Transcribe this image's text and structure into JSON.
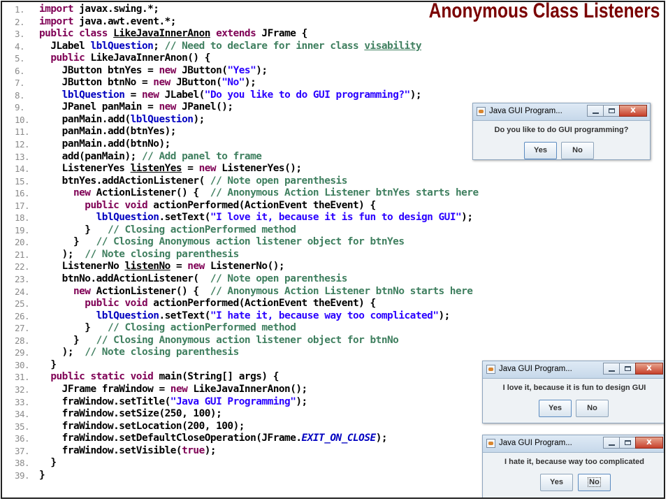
{
  "slide_title": "Anonymous Class Listeners",
  "code_lines": [
    {
      "n": "1.",
      "segs": [
        {
          "c": "kw",
          "t": "import "
        },
        {
          "c": "id",
          "t": "javax.swing.*;"
        }
      ]
    },
    {
      "n": "2.",
      "segs": [
        {
          "c": "kw",
          "t": "import "
        },
        {
          "c": "id",
          "t": "java.awt.event.*;"
        }
      ]
    },
    {
      "n": "3.",
      "segs": [
        {
          "c": "kw",
          "t": "public class "
        },
        {
          "c": "id ul",
          "t": "LikeJavaInnerAnon"
        },
        {
          "c": "kw",
          "t": " extends "
        },
        {
          "c": "id",
          "t": "JFrame {"
        }
      ]
    },
    {
      "n": "4.",
      "segs": [
        {
          "c": "id",
          "t": "  JLabel "
        },
        {
          "c": "vr",
          "t": "lblQuestion"
        },
        {
          "c": "id",
          "t": "; "
        },
        {
          "c": "cm",
          "t": "// Need to declare for inner class "
        },
        {
          "c": "cm ul",
          "t": "visability"
        }
      ]
    },
    {
      "n": "5.",
      "segs": [
        {
          "c": "kw",
          "t": "  public "
        },
        {
          "c": "id",
          "t": "LikeJavaInnerAnon() {"
        }
      ]
    },
    {
      "n": "6.",
      "segs": [
        {
          "c": "id",
          "t": "    JButton btnYes = "
        },
        {
          "c": "kw",
          "t": "new "
        },
        {
          "c": "id",
          "t": "JButton("
        },
        {
          "c": "st",
          "t": "\"Yes\""
        },
        {
          "c": "id",
          "t": ");"
        }
      ]
    },
    {
      "n": "7.",
      "segs": [
        {
          "c": "id",
          "t": "    JButton btnNo = "
        },
        {
          "c": "kw",
          "t": "new "
        },
        {
          "c": "id",
          "t": "JButton("
        },
        {
          "c": "st",
          "t": "\"No\""
        },
        {
          "c": "id",
          "t": ");"
        }
      ]
    },
    {
      "n": "8.",
      "segs": [
        {
          "c": "vr",
          "t": "    lblQuestion"
        },
        {
          "c": "id",
          "t": " = "
        },
        {
          "c": "kw",
          "t": "new "
        },
        {
          "c": "id",
          "t": "JLabel("
        },
        {
          "c": "st",
          "t": "\"Do you like to do GUI programming?\""
        },
        {
          "c": "id",
          "t": ");"
        }
      ]
    },
    {
      "n": "9.",
      "segs": [
        {
          "c": "id",
          "t": "    JPanel panMain = "
        },
        {
          "c": "kw",
          "t": "new "
        },
        {
          "c": "id",
          "t": "JPanel();"
        }
      ]
    },
    {
      "n": "10.",
      "segs": [
        {
          "c": "id",
          "t": "    panMain.add("
        },
        {
          "c": "vr",
          "t": "lblQuestion"
        },
        {
          "c": "id",
          "t": ");"
        }
      ]
    },
    {
      "n": "11.",
      "segs": [
        {
          "c": "id",
          "t": "    panMain.add(btnYes);"
        }
      ]
    },
    {
      "n": "12.",
      "segs": [
        {
          "c": "id",
          "t": "    panMain.add(btnNo);"
        }
      ]
    },
    {
      "n": "13.",
      "segs": [
        {
          "c": "id",
          "t": "    add(panMain); "
        },
        {
          "c": "cm",
          "t": "// Add panel to frame"
        }
      ]
    },
    {
      "n": "14.",
      "segs": [
        {
          "c": "id",
          "t": "    ListenerYes "
        },
        {
          "c": "id ul",
          "t": "listenYes"
        },
        {
          "c": "id",
          "t": " = "
        },
        {
          "c": "kw",
          "t": "new "
        },
        {
          "c": "id",
          "t": "ListenerYes();"
        }
      ]
    },
    {
      "n": "15.",
      "segs": [
        {
          "c": "id",
          "t": "    btnYes.addActionListener( "
        },
        {
          "c": "cm",
          "t": "// Note open parenthesis"
        }
      ]
    },
    {
      "n": "16.",
      "segs": [
        {
          "c": "kw",
          "t": "      new "
        },
        {
          "c": "id",
          "t": "ActionListener() {  "
        },
        {
          "c": "cm",
          "t": "// Anonymous Action Listener btnYes starts here"
        }
      ]
    },
    {
      "n": "17.",
      "segs": [
        {
          "c": "kw",
          "t": "        public void "
        },
        {
          "c": "id",
          "t": "actionPerformed(ActionEvent theEvent) {"
        }
      ]
    },
    {
      "n": "18.",
      "segs": [
        {
          "c": "vr",
          "t": "          lblQuestion"
        },
        {
          "c": "id",
          "t": ".setText("
        },
        {
          "c": "st",
          "t": "\"I love it, because it is fun to design GUI\""
        },
        {
          "c": "id",
          "t": ");"
        }
      ]
    },
    {
      "n": "19.",
      "segs": [
        {
          "c": "id",
          "t": "        }   "
        },
        {
          "c": "cm",
          "t": "// Closing actionPerformed method"
        }
      ]
    },
    {
      "n": "20.",
      "segs": [
        {
          "c": "id",
          "t": "      }   "
        },
        {
          "c": "cm",
          "t": "// Closing Anonymous action listener object for btnYes"
        }
      ]
    },
    {
      "n": "21.",
      "segs": [
        {
          "c": "id",
          "t": "    );  "
        },
        {
          "c": "cm",
          "t": "// Note closing parenthesis"
        }
      ]
    },
    {
      "n": "22.",
      "segs": [
        {
          "c": "id",
          "t": "    ListenerNo "
        },
        {
          "c": "id ul",
          "t": "listenNo"
        },
        {
          "c": "id",
          "t": " = "
        },
        {
          "c": "kw",
          "t": "new "
        },
        {
          "c": "id",
          "t": "ListenerNo();"
        }
      ]
    },
    {
      "n": "23.",
      "segs": [
        {
          "c": "id",
          "t": "    btnNo.addActionListener(  "
        },
        {
          "c": "cm",
          "t": "// Note open parenthesis"
        }
      ]
    },
    {
      "n": "24.",
      "segs": [
        {
          "c": "kw",
          "t": "      new "
        },
        {
          "c": "id",
          "t": "ActionListener() {  "
        },
        {
          "c": "cm",
          "t": "// Anonymous Action Listener btnNo starts here"
        }
      ]
    },
    {
      "n": "25.",
      "segs": [
        {
          "c": "kw",
          "t": "        public void "
        },
        {
          "c": "id",
          "t": "actionPerformed(ActionEvent theEvent) {"
        }
      ]
    },
    {
      "n": "26.",
      "segs": [
        {
          "c": "vr",
          "t": "          lblQuestion"
        },
        {
          "c": "id",
          "t": ".setText("
        },
        {
          "c": "st",
          "t": "\"I hate it, because way too complicated\""
        },
        {
          "c": "id",
          "t": ");"
        }
      ]
    },
    {
      "n": "27.",
      "segs": [
        {
          "c": "id",
          "t": "        }   "
        },
        {
          "c": "cm",
          "t": "// Closing actionPerformed method"
        }
      ]
    },
    {
      "n": "28.",
      "segs": [
        {
          "c": "id",
          "t": "      }   "
        },
        {
          "c": "cm",
          "t": "// Closing Anonymous action listener object for btnNo"
        }
      ]
    },
    {
      "n": "29.",
      "segs": [
        {
          "c": "id",
          "t": "    );  "
        },
        {
          "c": "cm",
          "t": "// Note closing parenthesis"
        }
      ]
    },
    {
      "n": "30.",
      "segs": [
        {
          "c": "id",
          "t": "  }"
        }
      ]
    },
    {
      "n": "31.",
      "segs": [
        {
          "c": "kw",
          "t": "  public static void "
        },
        {
          "c": "id",
          "t": "main(String[] args) {"
        }
      ]
    },
    {
      "n": "32.",
      "segs": [
        {
          "c": "id",
          "t": "    JFrame fraWindow = "
        },
        {
          "c": "kw",
          "t": "new "
        },
        {
          "c": "id",
          "t": "LikeJavaInnerAnon();"
        }
      ]
    },
    {
      "n": "33.",
      "segs": [
        {
          "c": "id",
          "t": "    fraWindow.setTitle("
        },
        {
          "c": "st",
          "t": "\"Java GUI Programming\""
        },
        {
          "c": "id",
          "t": ");"
        }
      ]
    },
    {
      "n": "34.",
      "segs": [
        {
          "c": "id",
          "t": "    fraWindow.setSize(250, 100);"
        }
      ]
    },
    {
      "n": "35.",
      "segs": [
        {
          "c": "id",
          "t": "    fraWindow.setLocation(200, 100);"
        }
      ]
    },
    {
      "n": "36.",
      "segs": [
        {
          "c": "id",
          "t": "    fraWindow.setDefaultCloseOperation(JFrame."
        },
        {
          "c": "sn",
          "t": "EXIT_ON_CLOSE"
        },
        {
          "c": "id",
          "t": ");"
        }
      ]
    },
    {
      "n": "37.",
      "segs": [
        {
          "c": "id",
          "t": "    fraWindow.setVisible("
        },
        {
          "c": "kw",
          "t": "true"
        },
        {
          "c": "id",
          "t": ");"
        }
      ]
    },
    {
      "n": "38.",
      "segs": [
        {
          "c": "id",
          "t": "  }"
        }
      ]
    },
    {
      "n": "39.",
      "segs": [
        {
          "c": "id",
          "t": "}"
        }
      ]
    }
  ],
  "windows": [
    {
      "title": "Java GUI Program...",
      "label": "Do you like to do GUI programming?",
      "yes": "Yes",
      "no": "No"
    },
    {
      "title": "Java GUI Program...",
      "label": "I love it, because it is fun to design GUI",
      "yes": "Yes",
      "no": "No"
    },
    {
      "title": "Java GUI Program...",
      "label": "I hate it, because way too complicated",
      "yes": "Yes",
      "no": "No"
    }
  ]
}
